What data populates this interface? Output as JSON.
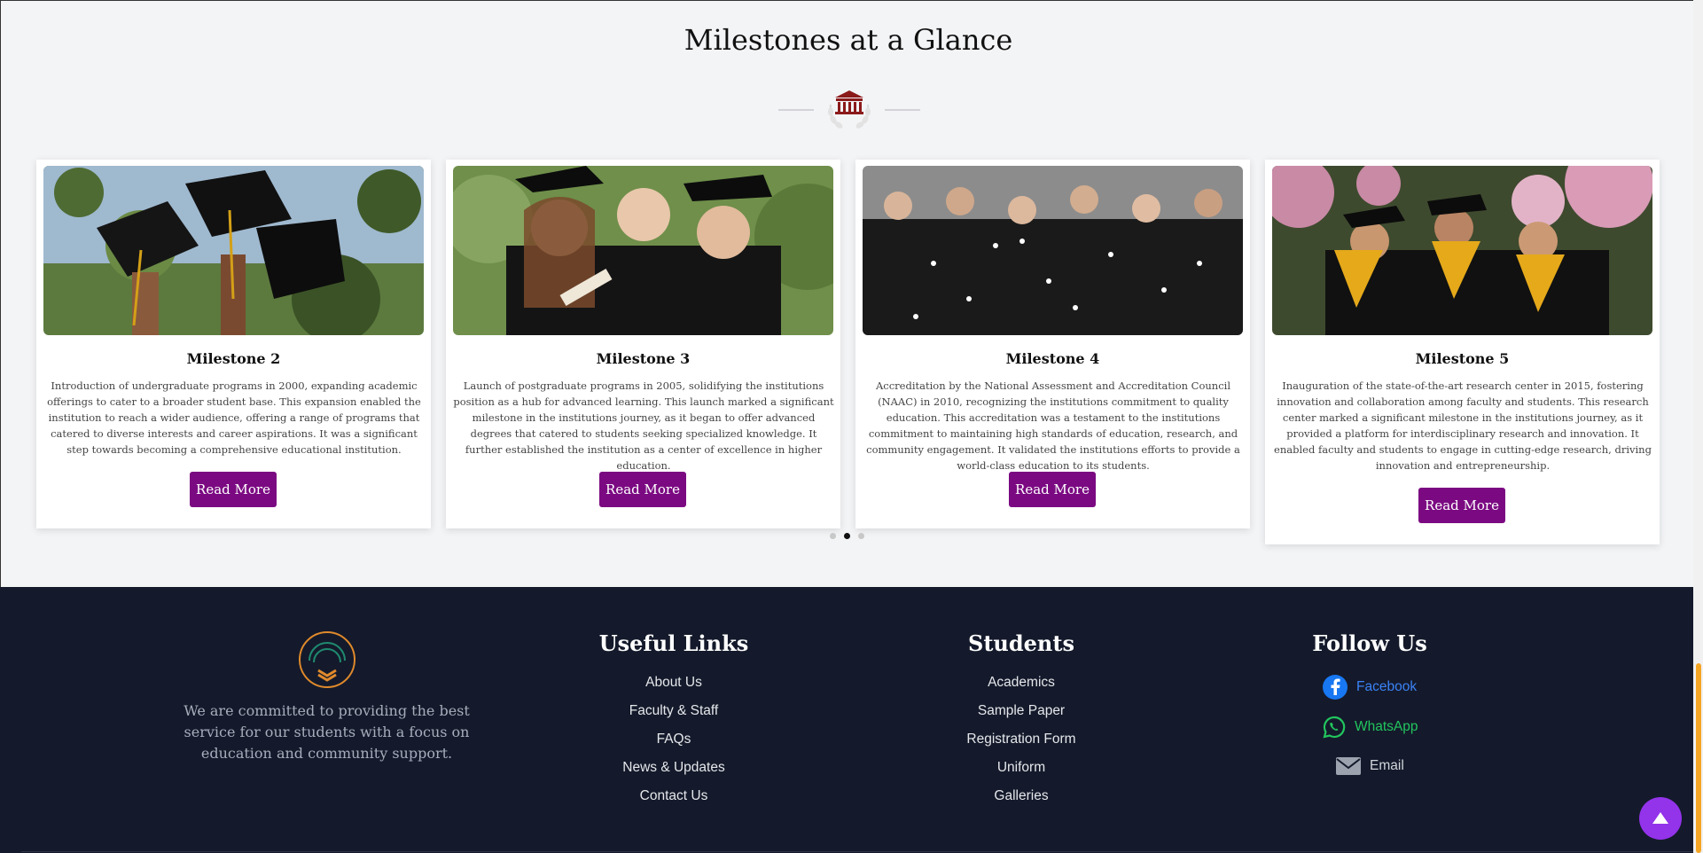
{
  "section": {
    "title": "Milestones at a Glance",
    "divider_icon": "institution-icon"
  },
  "milestones": [
    {
      "title": "Milestone 2",
      "description": "Introduction of undergraduate programs in 2000, expanding academic offerings to cater to a broader student base. This expansion enabled the institution to reach a wider audience, offering a range of programs that catered to diverse interests and career aspirations. It was a significant step towards becoming a comprehensive educational institution.",
      "button": "Read More"
    },
    {
      "title": "Milestone 3",
      "description": "Launch of postgraduate programs in 2005, solidifying the institutions position as a hub for advanced learning. This launch marked a significant milestone in the institutions journey, as it began to offer advanced degrees that catered to students seeking specialized knowledge. It further established the institution as a center of excellence in higher education.",
      "button": "Read More"
    },
    {
      "title": "Milestone 4",
      "description": "Accreditation by the National Assessment and Accreditation Council (NAAC) in 2010, recognizing the institutions commitment to quality education. This accreditation was a testament to the institutions commitment to maintaining high standards of education, research, and community engagement. It validated the institutions efforts to provide a world-class education to its students.",
      "button": "Read More"
    },
    {
      "title": "Milestone 5",
      "description": "Inauguration of the state-of-the-art research center in 2015, fostering innovation and collaboration among faculty and students. This research center marked a significant milestone in the institutions journey, as it provided a platform for interdisciplinary research and innovation. It enabled faculty and students to engage in cutting-edge research, driving innovation and entrepreneurship.",
      "button": "Read More"
    }
  ],
  "carousel": {
    "dots": 3,
    "active_dot": 2
  },
  "footer": {
    "description": "We are committed to providing the best service for our students with a focus on education and community support.",
    "useful_links": {
      "title": "Useful Links",
      "items": [
        "About Us",
        "Faculty & Staff",
        "FAQs",
        "News & Updates",
        "Contact Us"
      ]
    },
    "students": {
      "title": "Students",
      "items": [
        "Academics",
        "Sample Paper",
        "Registration Form",
        "Uniform",
        "Galleries"
      ]
    },
    "follow": {
      "title": "Follow Us",
      "items": [
        {
          "label": "Facebook",
          "icon": "facebook-icon",
          "color": "#3b82f6"
        },
        {
          "label": "WhatsApp",
          "icon": "whatsapp-icon",
          "color": "#22c55e"
        },
        {
          "label": "Email",
          "icon": "mail-icon",
          "color": "#d1d5db"
        }
      ]
    }
  },
  "colors": {
    "button": "#7b0a82",
    "footer_bg": "#141a2b",
    "accent_icon": "#8b1a1a",
    "scroll_top": "#9333ea"
  }
}
